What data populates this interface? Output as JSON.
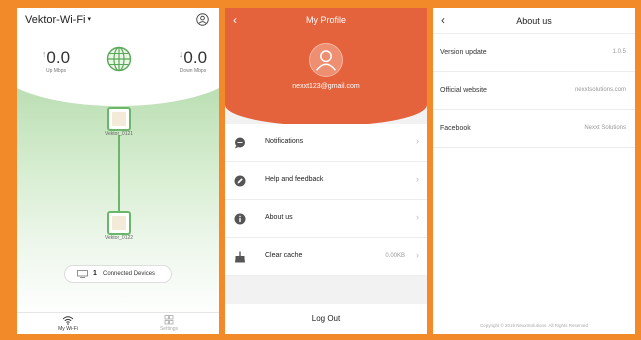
{
  "home": {
    "network_name": "Vektor-Wi-Fi",
    "caret": "▾",
    "up_value": "0.0",
    "up_label": "Up Mbps",
    "down_value": "0.0",
    "down_label": "Down Mbps",
    "nodes": [
      {
        "label": "Vektor_0121"
      },
      {
        "label": "Vektor_0122"
      }
    ],
    "connected_count": "1",
    "connected_label": "Connected Devices",
    "nav": [
      {
        "label": "My Wi-Fi",
        "icon": "wifi-icon"
      },
      {
        "label": "Settings",
        "icon": "settings-grid-icon"
      }
    ]
  },
  "profile": {
    "title": "My Profile",
    "back": "‹",
    "email": "nexxt123@gmail.com",
    "menu": [
      {
        "label": "Notifications",
        "icon": "chat-bubble-icon",
        "value": ""
      },
      {
        "label": "Help and feedback",
        "icon": "edit-icon",
        "value": ""
      },
      {
        "label": "About us",
        "icon": "info-icon",
        "value": ""
      },
      {
        "label": "Clear cache",
        "icon": "broom-icon",
        "value": "0.00KB"
      }
    ],
    "chevron": "›",
    "logout_label": "Log Out"
  },
  "about": {
    "title": "About us",
    "back": "‹",
    "rows": [
      {
        "key": "Version update",
        "value": "1.0.5"
      },
      {
        "key": "Official website",
        "value": "nexxtsolutions.com"
      },
      {
        "key": "Facebook",
        "value": "Nexxt Solutions"
      }
    ],
    "copyright": "Copyright © 2019 NexxtSolutions. All Rights Reserved"
  },
  "colors": {
    "frame": "#f28a2a",
    "profile_header": "#e4623c",
    "green_accent": "#6cb66c"
  }
}
